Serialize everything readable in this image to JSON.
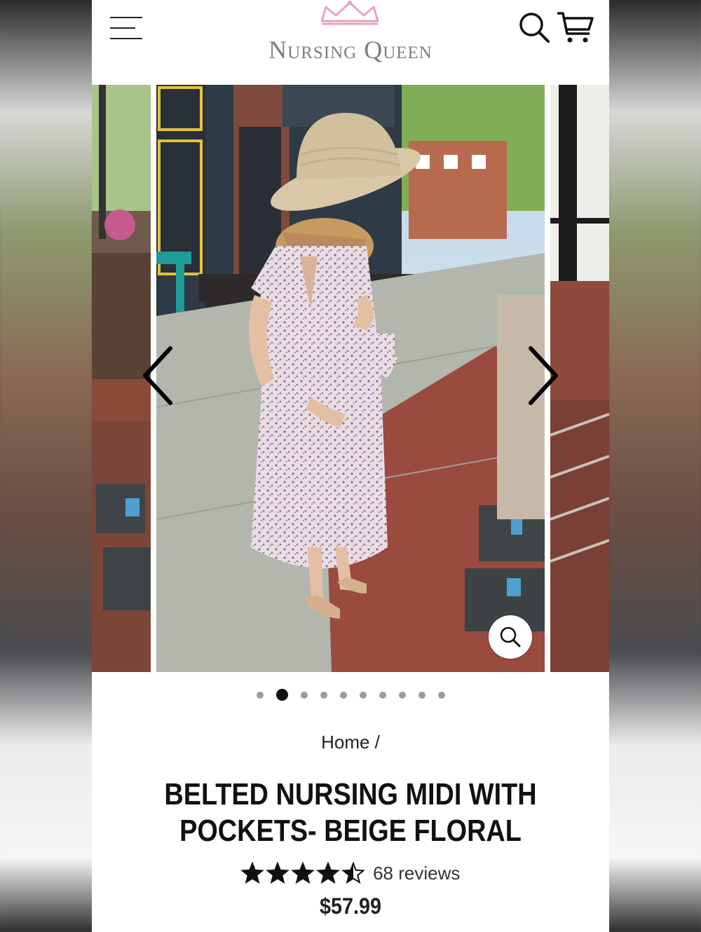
{
  "brand": {
    "name": "Nursing Queen",
    "logo_color": "#7d7d7d",
    "crown_color": "#e8a3b6"
  },
  "header": {
    "menu_icon": "hamburger-icon",
    "search_icon": "search-icon",
    "cart_icon": "cart-icon"
  },
  "gallery": {
    "slide_count": 10,
    "active_index": 1,
    "prev_icon": "chevron-left-icon",
    "next_icon": "chevron-right-icon",
    "zoom_icon": "zoom-icon"
  },
  "breadcrumb": {
    "home": "Home",
    "separator": "/"
  },
  "product": {
    "title": "BELTED NURSING MIDI WITH POCKETS- BEIGE FLORAL",
    "rating": 4.5,
    "rating_max": 5,
    "reviews": "68 reviews",
    "price": "$57.99"
  }
}
